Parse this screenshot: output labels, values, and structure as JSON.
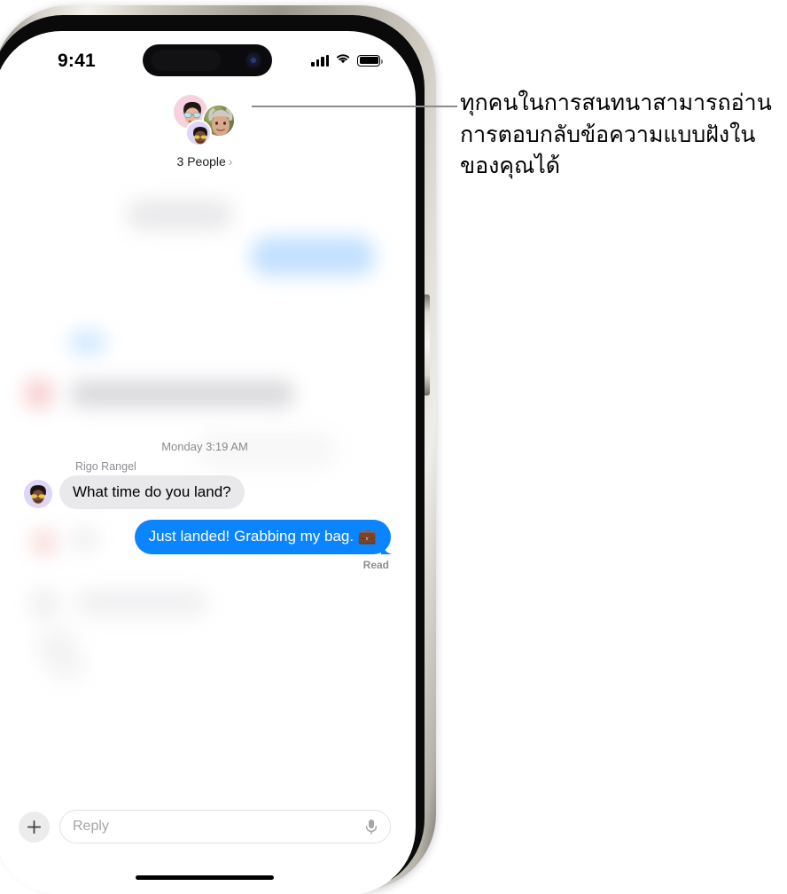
{
  "status_bar": {
    "time": "9:41",
    "signal_icon": "cellular-signal-icon",
    "wifi_icon": "wifi-icon",
    "battery_icon": "battery-icon"
  },
  "group_header": {
    "participants_label": "3 People",
    "chevron": "›",
    "avatars": [
      {
        "name": "avatar-memoji-pink",
        "bg": "#f6d3dd"
      },
      {
        "name": "avatar-photo-person",
        "bg": "#c2b28a"
      },
      {
        "name": "avatar-memoji-purple",
        "bg": "#ded5f7"
      }
    ]
  },
  "conversation": {
    "timestamp": "Monday 3:19 AM",
    "incoming": {
      "sender": "Rigo Rangel",
      "text": "What time do you land?"
    },
    "outgoing": {
      "text": "Just landed! Grabbing my bag. 💼",
      "status": "Read"
    }
  },
  "input_bar": {
    "add_label": "+",
    "reply_placeholder": "Reply",
    "mic_icon": "microphone-icon",
    "plus_icon": "plus-icon"
  },
  "callout": {
    "text": "ทุกคนในการสนทนาสามารถอ่านการตอบกลับข้อความแบบฝังในของคุณได้"
  },
  "colors": {
    "outgoing_bubble": "#0b84ff",
    "incoming_bubble": "#e9e9eb",
    "secondary_text": "#8e8e93",
    "leader_line": "#8c8c8c"
  }
}
